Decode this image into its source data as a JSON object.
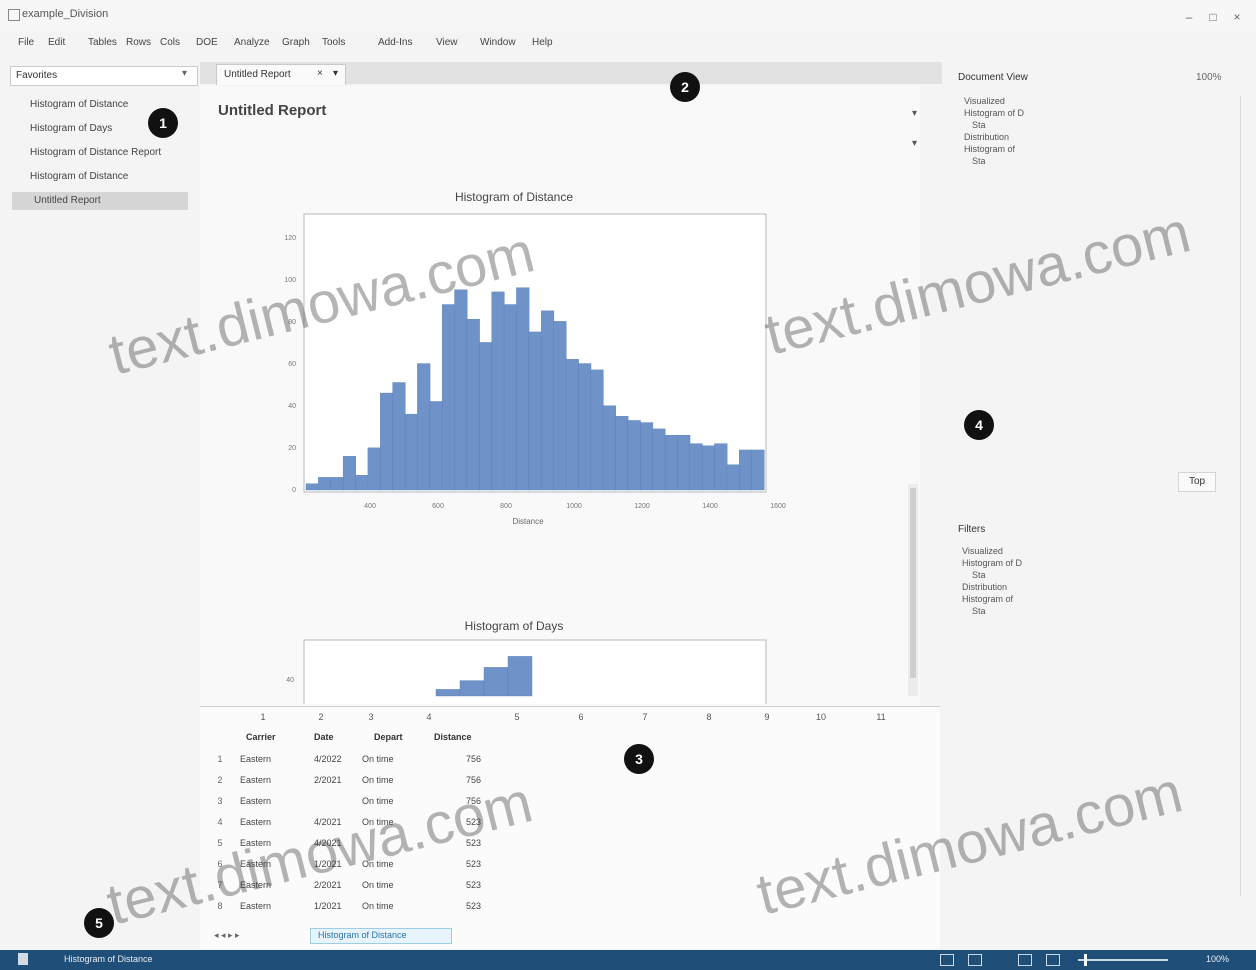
{
  "window": {
    "title": "example_Division",
    "min_icon": "minimize-icon",
    "max_icon": "maximize-icon",
    "close_icon": "close-icon"
  },
  "menu": [
    "File",
    "Edit",
    "Tables",
    "Rows",
    "Cols",
    "DOE",
    "Analyze",
    "Graph",
    "Tools",
    "Add-Ins",
    "View",
    "Window",
    "Help"
  ],
  "left_panel": {
    "dropdown": "Favorites",
    "items": [
      "Histogram of Distance",
      "Histogram of Days",
      "Histogram of Distance Report",
      "Histogram of Distance",
      "Untitled Report"
    ],
    "selected_index": 4
  },
  "tabs": [
    {
      "label": "Untitled Report",
      "close": "×",
      "menu": "▾"
    }
  ],
  "report": {
    "title": "Untitled Report"
  },
  "chart_data": [
    {
      "type": "bar",
      "title": "Histogram of Distance",
      "xlabel": "Distance",
      "ylabel": "",
      "x_ticks": [
        "400",
        "600",
        "800",
        "1000",
        "1200",
        "1400",
        "1600"
      ],
      "y_ticks": [
        "0",
        "20",
        "40",
        "60",
        "80",
        "100",
        "120"
      ],
      "values": [
        3,
        6,
        6,
        16,
        7,
        20,
        46,
        51,
        36,
        60,
        42,
        88,
        95,
        81,
        70,
        94,
        88,
        96,
        75,
        85,
        80,
        62,
        60,
        57,
        40,
        35,
        33,
        32,
        29,
        26,
        26,
        22,
        21,
        22,
        12,
        19,
        19
      ],
      "ylim": [
        0,
        130
      ],
      "grid": false
    },
    {
      "type": "bar",
      "title": "Histogram of Days",
      "xlabel": "",
      "ylabel": "",
      "y_ticks": [
        "40"
      ],
      "values": [
        6,
        14,
        26,
        36
      ],
      "ylim": [
        0,
        40
      ],
      "grid": false
    }
  ],
  "report_controls": {
    "ctl1": "▾",
    "ctl2": "▾"
  },
  "right_panel": {
    "structure_title": "Document View",
    "size_label": "100%",
    "structure_items": [
      "Visualized",
      "Histogram of D",
      "Sta",
      "Distribution",
      "Histogram of",
      "Sta"
    ],
    "button_label": "Top",
    "properties_title": "Filters",
    "property_items": [
      "Visualized",
      "Histogram of D",
      "Sta",
      "Distribution",
      "Histogram of",
      "Sta"
    ]
  },
  "table": {
    "col_heads": [
      "1",
      "2",
      "3",
      "4",
      "5",
      "6",
      "7",
      "8",
      "9",
      "10",
      "11"
    ],
    "columns": [
      "Carrier",
      "Date",
      "Depart",
      "Distance"
    ],
    "rows": [
      {
        "n": "1",
        "carrier": "Eastern",
        "date": "4/2022",
        "depart": "On time",
        "distance": "756"
      },
      {
        "n": "2",
        "carrier": "Eastern",
        "date": "2/2021",
        "depart": "On time",
        "distance": "756"
      },
      {
        "n": "3",
        "carrier": "Eastern",
        "date": "",
        "depart": "On time",
        "distance": "756"
      },
      {
        "n": "4",
        "carrier": "Eastern",
        "date": "4/2021",
        "depart": "On time",
        "distance": "523"
      },
      {
        "n": "5",
        "carrier": "Eastern",
        "date": "4/2021",
        "depart": "",
        "distance": "523"
      },
      {
        "n": "6",
        "carrier": "Eastern",
        "date": "1/2021",
        "depart": "On time",
        "distance": "523"
      },
      {
        "n": "7",
        "carrier": "Eastern",
        "date": "2/2021",
        "depart": "On time",
        "distance": "523"
      },
      {
        "n": "8",
        "carrier": "Eastern",
        "date": "1/2021",
        "depart": "On time",
        "distance": "523"
      }
    ],
    "sheet_tab": "Histogram of Distance",
    "nav": "◂ ◂ ▸ ▸"
  },
  "status": {
    "text": "Histogram of Distance",
    "zoom": "100%"
  },
  "callouts": [
    "1",
    "2",
    "3",
    "4",
    "5"
  ],
  "watermark": "text.dimowa.com"
}
